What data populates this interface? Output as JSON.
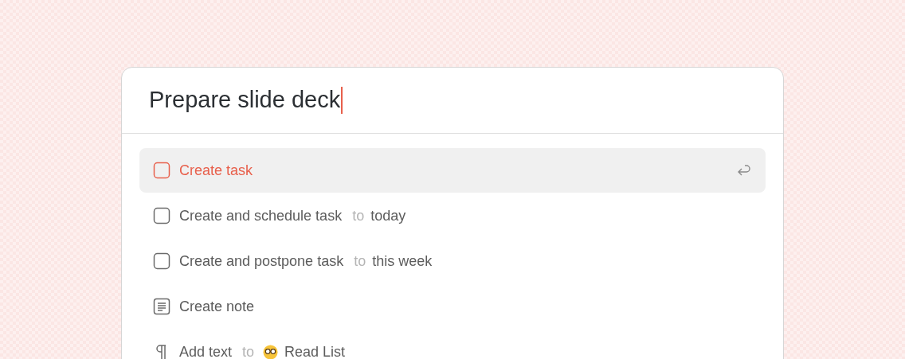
{
  "input": {
    "value": "Prepare slide deck"
  },
  "commands": [
    {
      "kind": "task",
      "label": "Create task",
      "selected": true
    },
    {
      "kind": "task",
      "label": "Create and schedule task",
      "connector": "to",
      "target": "today",
      "selected": false
    },
    {
      "kind": "task",
      "label": "Create and postpone task",
      "connector": "to",
      "target": "this week",
      "selected": false
    },
    {
      "kind": "note",
      "label": "Create note",
      "selected": false
    },
    {
      "kind": "text",
      "label": "Add text",
      "connector": "to",
      "target": "Read List",
      "target_emoji": true,
      "selected": false
    }
  ]
}
